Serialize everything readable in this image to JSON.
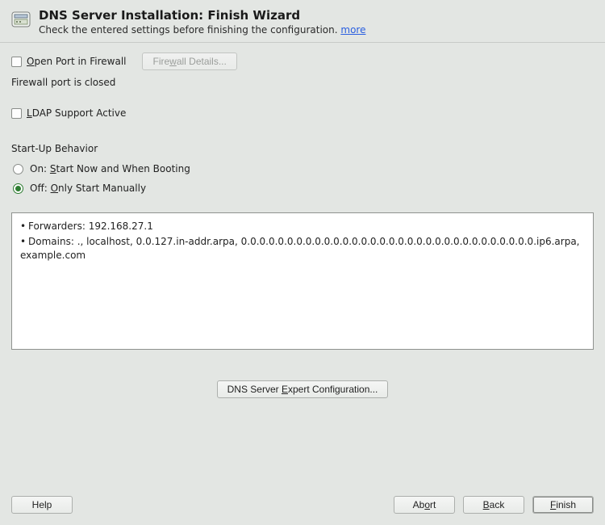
{
  "header": {
    "title": "DNS Server Installation: Finish Wizard",
    "subtitle_prefix": "Check the entered settings before finishing the configuration. ",
    "more_link": "more"
  },
  "firewall": {
    "open_port_pre": "O",
    "open_port_rest": "pen Port in Firewall",
    "details_pre": "Fire",
    "details_u": "w",
    "details_rest": "all Details...",
    "status": "Firewall port is closed"
  },
  "ldap": {
    "pre": "L",
    "rest": "DAP Support Active"
  },
  "startup": {
    "group_label": "Start-Up Behavior",
    "on_pre": "On: ",
    "on_u": "S",
    "on_rest": "tart Now and When Booting",
    "off_pre": "Off: ",
    "off_u": "O",
    "off_rest": "nly Start Manually"
  },
  "summary": {
    "forwarders_label": "Forwarders: ",
    "forwarders_value": "192.168.27.1",
    "domains_label": "Domains: ",
    "domains_value": "., localhost, 0.0.127.in-addr.arpa, 0.0.0.0.0.0.0.0.0.0.0.0.0.0.0.0.0.0.0.0.0.0.0.0.0.0.0.0.0.0.0.0.ip6.arpa, example.com"
  },
  "expert": {
    "pre": "DNS Server ",
    "u": "E",
    "rest": "xpert Configuration..."
  },
  "footer": {
    "help": "Help",
    "abort_pre": "Ab",
    "abort_u": "o",
    "abort_rest": "rt",
    "back_u": "B",
    "back_rest": "ack",
    "finish_u": "F",
    "finish_rest": "inish"
  }
}
